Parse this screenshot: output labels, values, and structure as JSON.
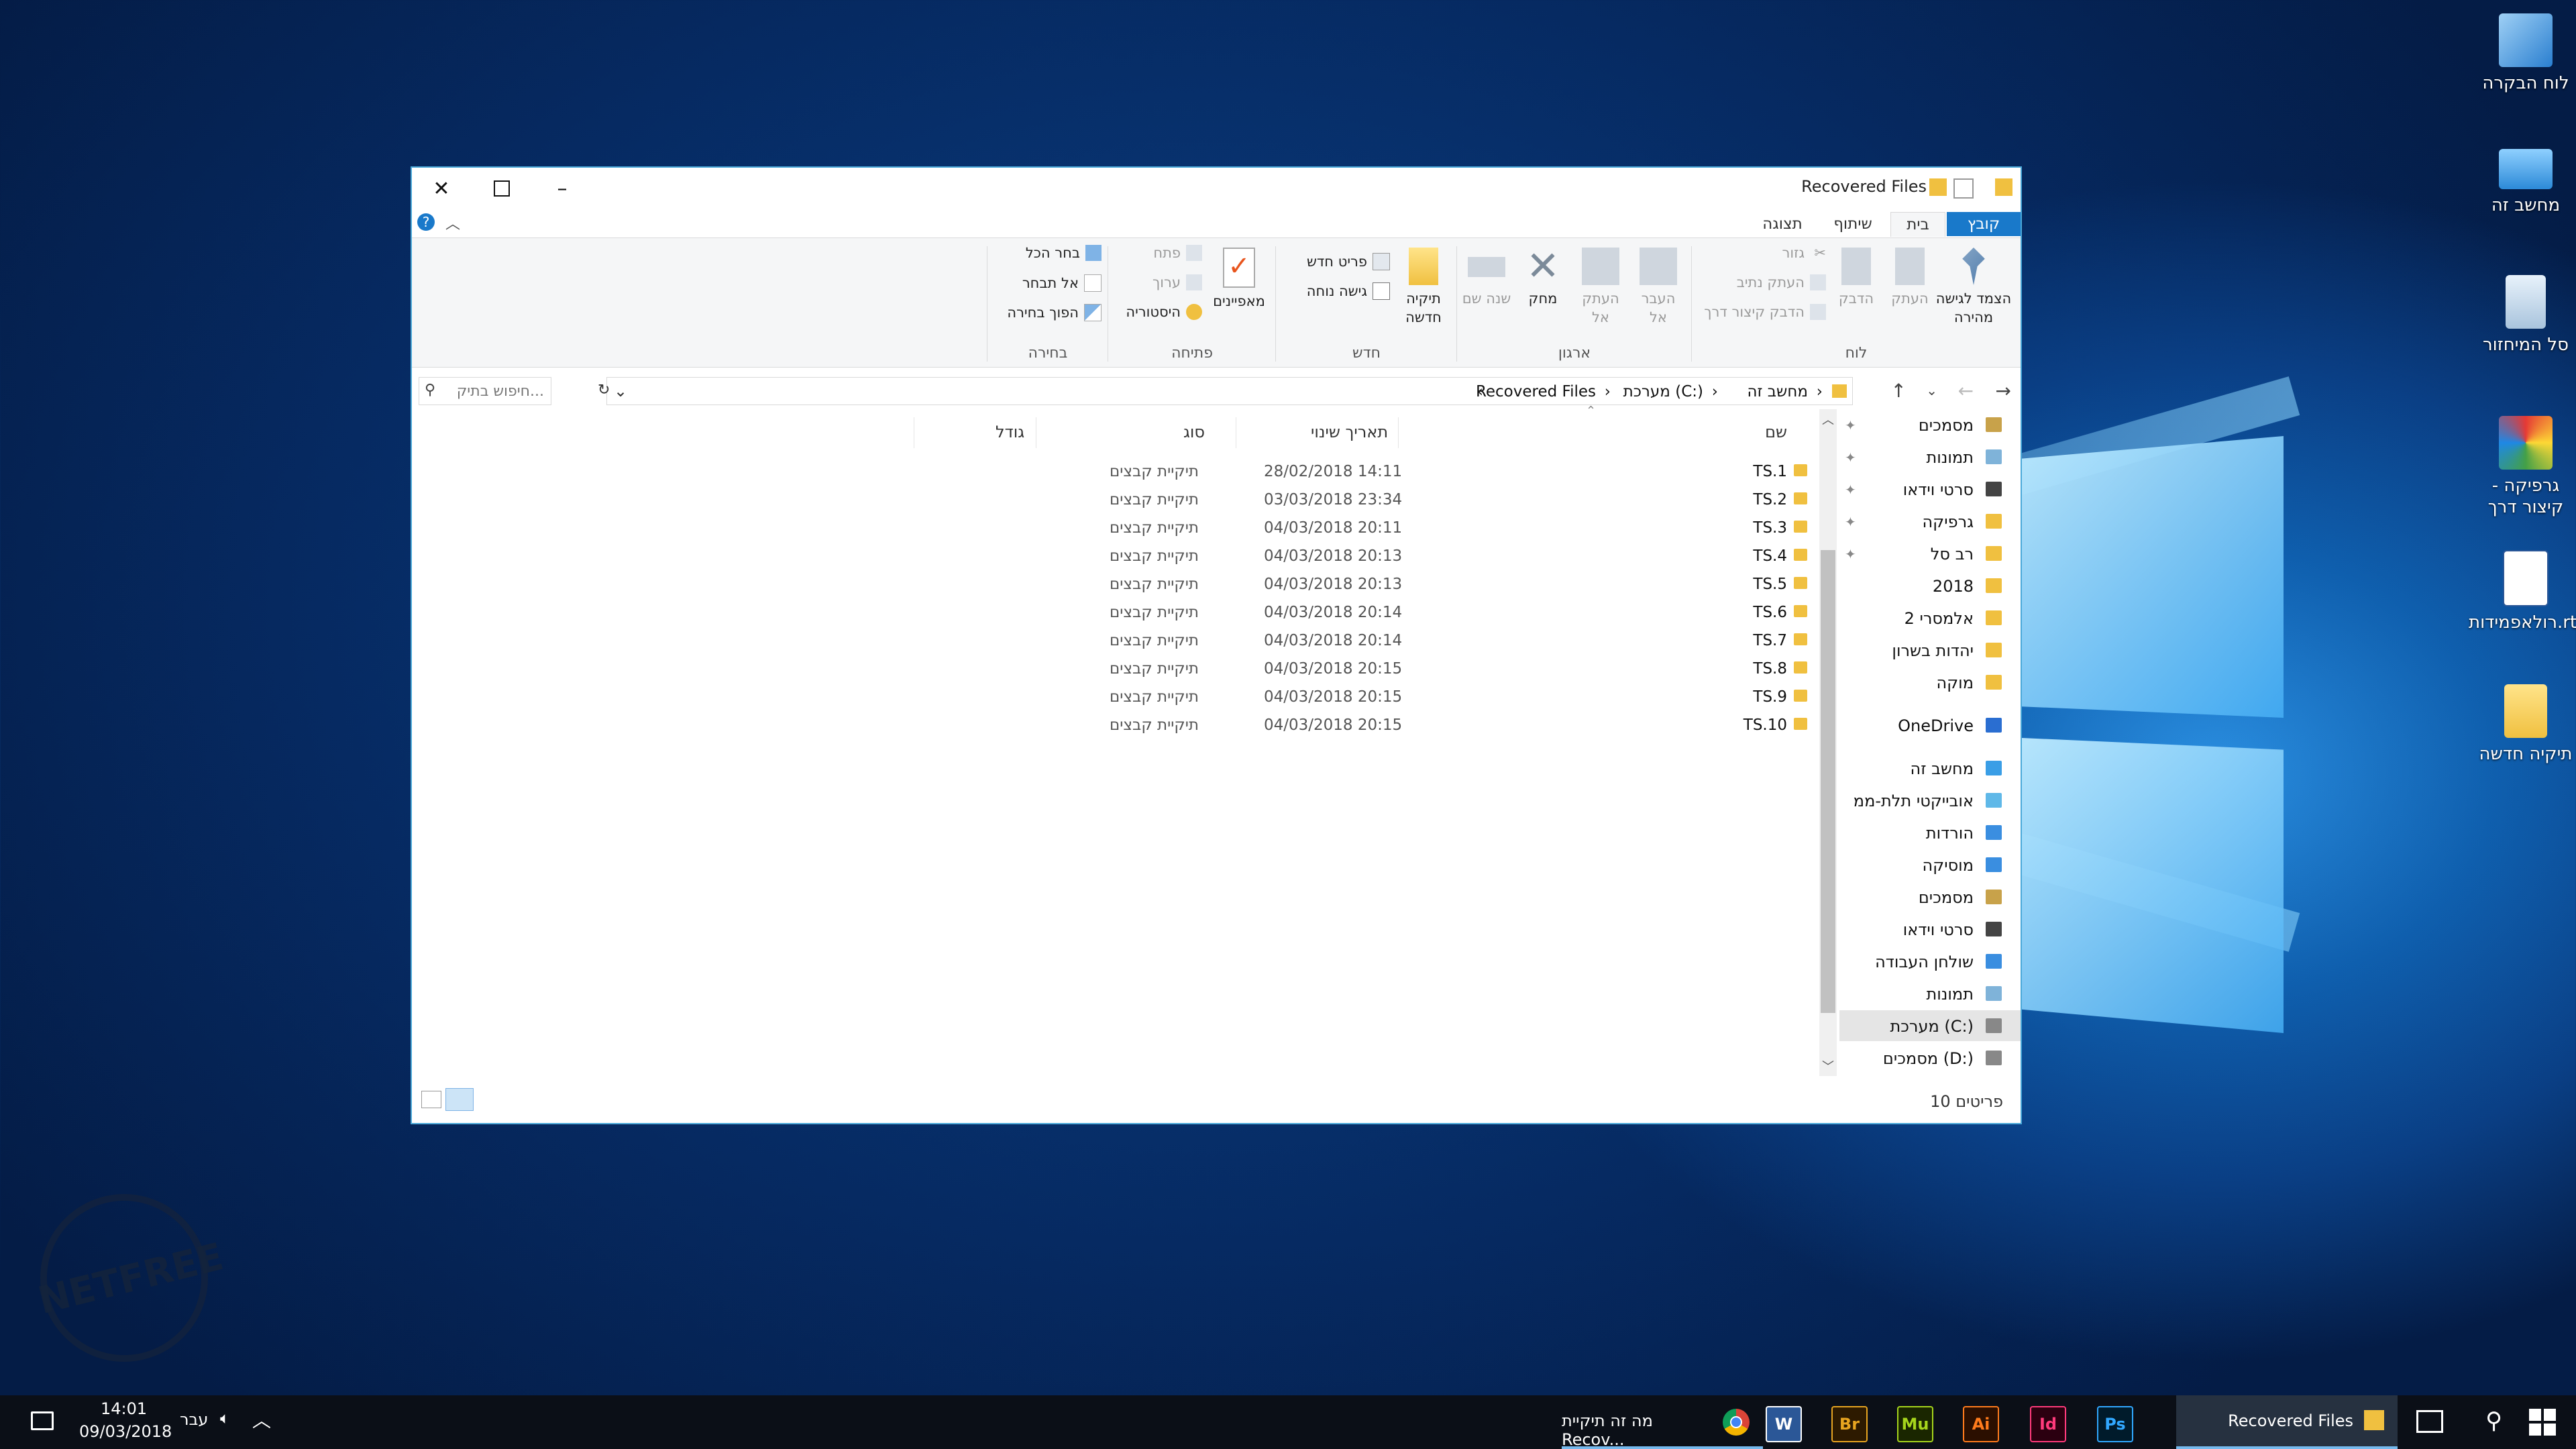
{
  "desktop": {
    "icons": [
      {
        "label": "לוח הבקרה",
        "icon": "control-panel-icon"
      },
      {
        "label": "מחשב זה",
        "icon": "this-pc-icon"
      },
      {
        "label": "סל המיחזור",
        "icon": "recycle-bin-icon"
      },
      {
        "label": "גרפיקה - קיצור דרך",
        "icon": "graphics-shortcut-icon"
      },
      {
        "label": "רולאפמידות.rtf",
        "icon": "word-document-icon"
      },
      {
        "label": "תיקיה חדשה",
        "icon": "new-folder-icon"
      }
    ],
    "watermark": "NETFREE"
  },
  "window": {
    "title": "Recovered Files",
    "tabs": [
      "קובץ",
      "בית",
      "שיתוף",
      "תצוגה"
    ],
    "active_tab": "בית",
    "ribbon": {
      "clipboard": {
        "label": "לוח",
        "pin": "הצמד לגישה מהירה",
        "copy": "העתק",
        "paste": "הדבק",
        "cut": "גזור",
        "copy_path": "העתק נתיב",
        "paste_shortcut": "הדבק קיצור דרך"
      },
      "organize": {
        "label": "ארגון",
        "move_to": "העבר אל",
        "copy_to": "העתק אל",
        "delete": "מחק",
        "rename": "שנה שם"
      },
      "new": {
        "label": "חדש",
        "new_folder": "תיקיה חדשה",
        "new_item": "פריט חדש",
        "easy_access": "גישה נוחה"
      },
      "open": {
        "label": "פתיחה",
        "properties": "מאפיינים",
        "open": "פתח",
        "edit": "ערוך",
        "history": "היסטוריה"
      },
      "select": {
        "label": "בחירה",
        "select_all": "בחר הכל",
        "select_none": "אל תבחר",
        "invert": "הפוך בחירה"
      }
    },
    "address": {
      "crumbs": [
        "מחשב זה",
        "מערכת (C:)",
        "Recovered Files"
      ],
      "search_placeholder": "חיפוש בתיק..."
    },
    "columns": {
      "name": "שם",
      "date": "תאריך שינוי",
      "type": "סוג",
      "size": "גודל"
    },
    "files": [
      {
        "name": "TS.1",
        "date": "28/02/2018 14:11",
        "type": "תיקיית קבצים"
      },
      {
        "name": "TS.2",
        "date": "03/03/2018 23:34",
        "type": "תיקיית קבצים"
      },
      {
        "name": "TS.3",
        "date": "04/03/2018 20:11",
        "type": "תיקיית קבצים"
      },
      {
        "name": "TS.4",
        "date": "04/03/2018 20:13",
        "type": "תיקיית קבצים"
      },
      {
        "name": "TS.5",
        "date": "04/03/2018 20:13",
        "type": "תיקיית קבצים"
      },
      {
        "name": "TS.6",
        "date": "04/03/2018 20:14",
        "type": "תיקיית קבצים"
      },
      {
        "name": "TS.7",
        "date": "04/03/2018 20:14",
        "type": "תיקיית קבצים"
      },
      {
        "name": "TS.8",
        "date": "04/03/2018 20:15",
        "type": "תיקיית קבצים"
      },
      {
        "name": "TS.9",
        "date": "04/03/2018 20:15",
        "type": "תיקיית קבצים"
      },
      {
        "name": "TS.10",
        "date": "04/03/2018 20:15",
        "type": "תיקיית קבצים"
      }
    ],
    "nav": [
      {
        "label": "מסמכים",
        "pinned": true,
        "color": "#c8a24a"
      },
      {
        "label": "תמונות",
        "pinned": true,
        "color": "#7fb3d9"
      },
      {
        "label": "סרטי וידאו",
        "pinned": true,
        "color": "#444"
      },
      {
        "label": "גרפיקה",
        "pinned": true,
        "color": "#f0c040"
      },
      {
        "label": "רב סל",
        "pinned": true,
        "color": "#f0c040"
      },
      {
        "label": "2018",
        "pinned": false,
        "color": "#f0c040"
      },
      {
        "label": "אלמסרי 2",
        "pinned": false,
        "color": "#f0c040"
      },
      {
        "label": "יהדות בשרון",
        "pinned": false,
        "color": "#f0c040"
      },
      {
        "label": "מוקה",
        "pinned": false,
        "color": "#f0c040"
      },
      {
        "label": "OneDrive",
        "pinned": false,
        "color": "#2a6ed1"
      },
      {
        "label": "מחשב זה",
        "pinned": false,
        "color": "#3a9ee6"
      },
      {
        "label": "אובייקטי תלת-ממ",
        "pinned": false,
        "color": "#5fb8e8"
      },
      {
        "label": "הורדות",
        "pinned": false,
        "color": "#3a8ee0"
      },
      {
        "label": "מוסיקה",
        "pinned": false,
        "color": "#3a8ee0"
      },
      {
        "label": "מסמכים",
        "pinned": false,
        "color": "#c8a24a"
      },
      {
        "label": "סרטי וידאו",
        "pinned": false,
        "color": "#444"
      },
      {
        "label": "שולחן העבודה",
        "pinned": false,
        "color": "#3a8ee0"
      },
      {
        "label": "תמונות",
        "pinned": false,
        "color": "#7fb3d9"
      },
      {
        "label": "מערכת (C:)",
        "pinned": false,
        "color": "#888"
      },
      {
        "label": "מסמכים (D:)",
        "pinned": false,
        "color": "#888"
      }
    ],
    "status_count": "10 פריטים"
  },
  "taskbar": {
    "active_window": "Recovered Files",
    "chrome_title": "מה זה תיקיית Recov...",
    "apps": [
      {
        "label": "W",
        "color": "#2b5797",
        "fg": "#fff"
      },
      {
        "label": "Br",
        "color": "#2d1a00",
        "fg": "#e7a420"
      },
      {
        "label": "Mu",
        "color": "#1a2600",
        "fg": "#a6d51c"
      },
      {
        "label": "Ai",
        "color": "#2b0f00",
        "fg": "#ff7b1c"
      },
      {
        "label": "Id",
        "color": "#2b0010",
        "fg": "#ff3a7b"
      },
      {
        "label": "Ps",
        "color": "#001b2b",
        "fg": "#31a8ff"
      }
    ],
    "language": "עבר",
    "time": "14:01",
    "date": "09/03/2018"
  },
  "colors": {
    "accent": "#1979ca",
    "folder": "#f0c040"
  }
}
